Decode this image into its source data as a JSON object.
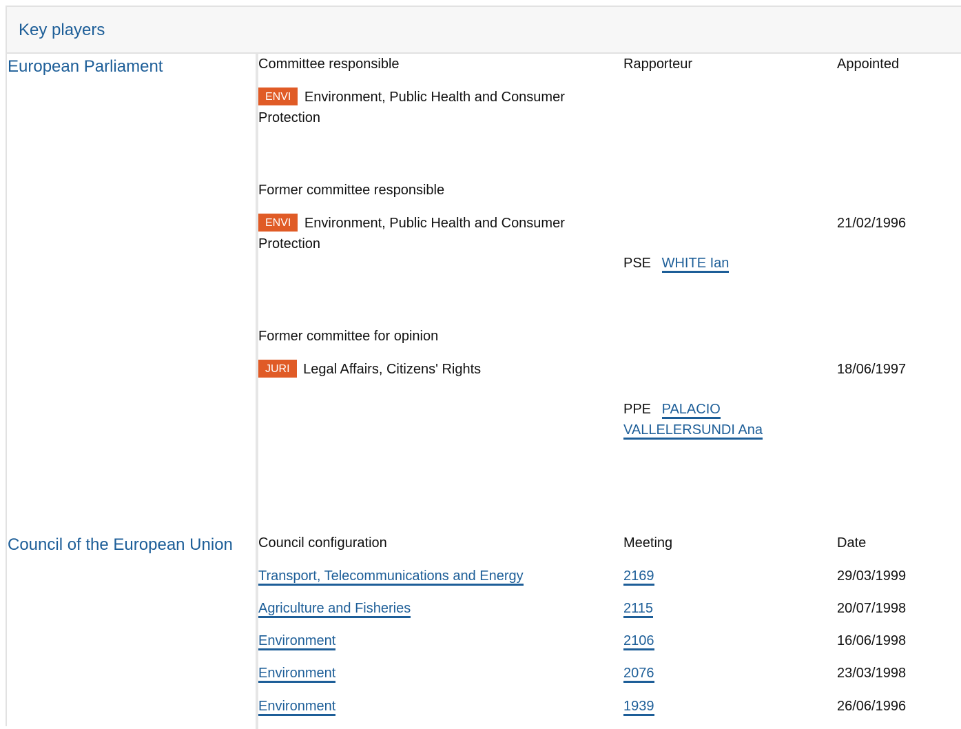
{
  "header": {
    "title": "Key players"
  },
  "parliament": {
    "title": "European Parliament",
    "columns": {
      "committee": "Committee responsible",
      "rapporteur": "Rapporteur",
      "appointed": "Appointed"
    },
    "responsible": {
      "badge": "ENVI",
      "name": "Environment, Public Health and Consumer Protection"
    },
    "former_responsible": {
      "label": "Former committee responsible",
      "badge": "ENVI",
      "name": "Environment, Public Health and Consumer Protection",
      "appointed": "21/02/1996",
      "rapporteur_group": "PSE",
      "rapporteur_name": "WHITE Ian"
    },
    "former_opinion": {
      "label": "Former committee for opinion",
      "badge": "JURI",
      "name": "Legal Affairs, Citizens' Rights",
      "appointed": "18/06/1997",
      "rapporteur_group": "PPE",
      "rapporteur_name_line1": "PALACIO",
      "rapporteur_name_line2": "VALLELERSUNDI Ana"
    }
  },
  "council": {
    "title": "Council of the European Union",
    "columns": {
      "configuration": "Council configuration",
      "meeting": "Meeting",
      "date": "Date"
    },
    "rows": [
      {
        "configuration": "Transport, Telecommunications and Energy",
        "meeting": "2169",
        "date": "29/03/1999"
      },
      {
        "configuration": "Agriculture and Fisheries",
        "meeting": "2115",
        "date": "20/07/1998"
      },
      {
        "configuration": "Environment",
        "meeting": "2106",
        "date": "16/06/1998"
      },
      {
        "configuration": "Environment",
        "meeting": "2076",
        "date": "23/03/1998"
      },
      {
        "configuration": "Environment",
        "meeting": "1939",
        "date": "26/06/1996"
      }
    ]
  },
  "colors": {
    "link": "#1d5e98",
    "badge": "#e05b26",
    "header_bg": "#f7f7f7",
    "border": "#e2e2e2"
  }
}
